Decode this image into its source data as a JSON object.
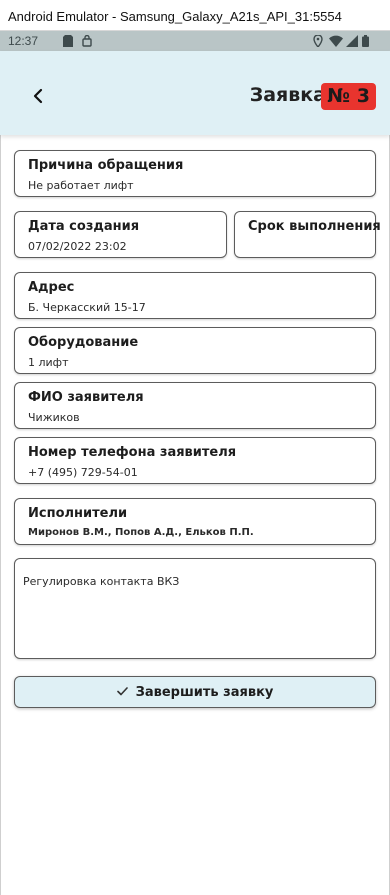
{
  "window": {
    "title": "Android Emulator - Samsung_Galaxy_A21s_API_31:5554"
  },
  "status_bar": {
    "time": "12:37",
    "icons": [
      "sd-card-icon",
      "security-icon",
      "location-icon",
      "wifi-icon",
      "signal-icon",
      "battery-icon"
    ]
  },
  "header": {
    "title": "Заявка",
    "number": "№ 3"
  },
  "fields": {
    "reason": {
      "label": "Причина обращения",
      "value": "Не работает лифт"
    },
    "created": {
      "label": "Дата создания",
      "value": "07/02/2022 23:02"
    },
    "deadline": {
      "label": "Срок выполнения",
      "value": ""
    },
    "address": {
      "label": "Адрес",
      "value": "Б. Черкасский 15-17"
    },
    "equipment": {
      "label": "Оборудование",
      "value": "1 лифт"
    },
    "applicant": {
      "label": "ФИО заявителя",
      "value": "Чижиков"
    },
    "phone": {
      "label": "Номер телефона заявителя",
      "value": "+7 (495) 729-54-01"
    },
    "executors": {
      "label": "Исполнители",
      "value": "Миронов В.М., Попов А.Д., Ельков П.П."
    }
  },
  "comment": "Регулировка контакта ВКЗ",
  "actions": {
    "complete_label": "Завершить заявку"
  },
  "colors": {
    "header_bg": "#dff0f5",
    "badge_bg": "#e8342e",
    "status_bar_bg": "#b9c5c6"
  }
}
